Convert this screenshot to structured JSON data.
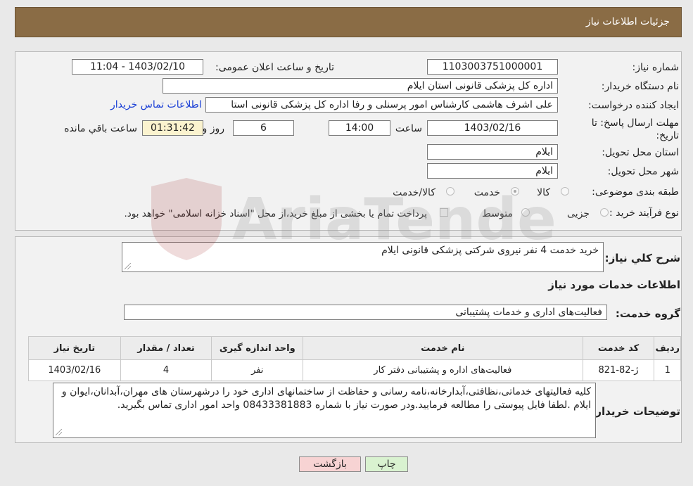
{
  "header": {
    "title": "جزئیات اطلاعات نیاز"
  },
  "form": {
    "need_number_label": "شماره نیاز:",
    "need_number": "1103003751000001",
    "announce_label": "تاریخ و ساعت اعلان عمومی:",
    "announce_value": "1403/02/10 - 11:04",
    "buyer_org_label": "نام دستگاه خریدار:",
    "buyer_org": "اداره کل پزشکی قانونی استان ایلام",
    "creator_label": "ایجاد کننده درخواست:",
    "creator": "علی اشرف هاشمی کارشناس امور پرسنلی و رفا اداره کل پزشکی قانونی استا",
    "contact_link": "اطلاعات تماس خریدار",
    "deadline_label": "مهلت ارسال پاسخ: تا تاریخ:",
    "deadline_date": "1403/02/16",
    "time_label": "ساعت",
    "deadline_time": "14:00",
    "days_value": "6",
    "days_label": "روز و",
    "remaining_time": "01:31:42",
    "remaining_label": "ساعت باقي مانده",
    "province_label": "استان محل تحویل:",
    "province": "ایلام",
    "city_label": "شهر محل تحویل:",
    "city": "ایلام",
    "category_label": "طبقه بندی موضوعی:",
    "category_options": [
      "کالا",
      "خدمت",
      "کالا/خدمت"
    ],
    "process_label": "نوع فرآیند خرید :",
    "process_options": [
      "جزیی",
      "متوسط"
    ],
    "payment_note": "پرداخت تمام یا بخشی از مبلغ خرید،از محل \"اسناد خزانه اسلامی\" خواهد بود."
  },
  "summary": {
    "label": "شرح کلي نياز:",
    "value": "خرید خدمت 4 نفر نیروی شرکتی پزشکی قانونی ایلام",
    "services_heading": "اطلاعات خدمات مورد نياز",
    "group_label": "گروه خدمت:",
    "group_value": "فعالیت‌های اداری و خدمات پشتیبانی"
  },
  "table": {
    "headers": [
      "ردیف",
      "کد خدمت",
      "نام خدمت",
      "واحد اندازه گیری",
      "تعداد / مقدار",
      "تاریخ نیاز"
    ],
    "rows": [
      {
        "row": "1",
        "code": "ژ-82-821",
        "name": "فعالیت‌های اداره و پشتیبانی دفتر کار",
        "unit": "نفر",
        "qty": "4",
        "date": "1403/02/16"
      }
    ]
  },
  "notes": {
    "label": "توضیحات خریدار:",
    "value": "کلیه فعالیتهای خدماتی،نظافتی،آبدارخانه،نامه رسانی و حفاظت از ساختمانهای اداری خود را درشهرستان های مهران،آبدانان،ایوان و ایلام .لطفا فایل پیوستی را مطالعه فرمایید.ودر صورت نیاز با شماره 08433381883 واحد امور اداری تماس بگیرید."
  },
  "buttons": {
    "print": "چاپ",
    "back": "بازگشت"
  },
  "watermark": {
    "text": "AriaTender.neT"
  },
  "colors": {
    "header_bg": "#8a6c45",
    "link": "#1a3fd6",
    "back_btn": "#f7d3d3",
    "print_btn": "#d9f2d0"
  }
}
